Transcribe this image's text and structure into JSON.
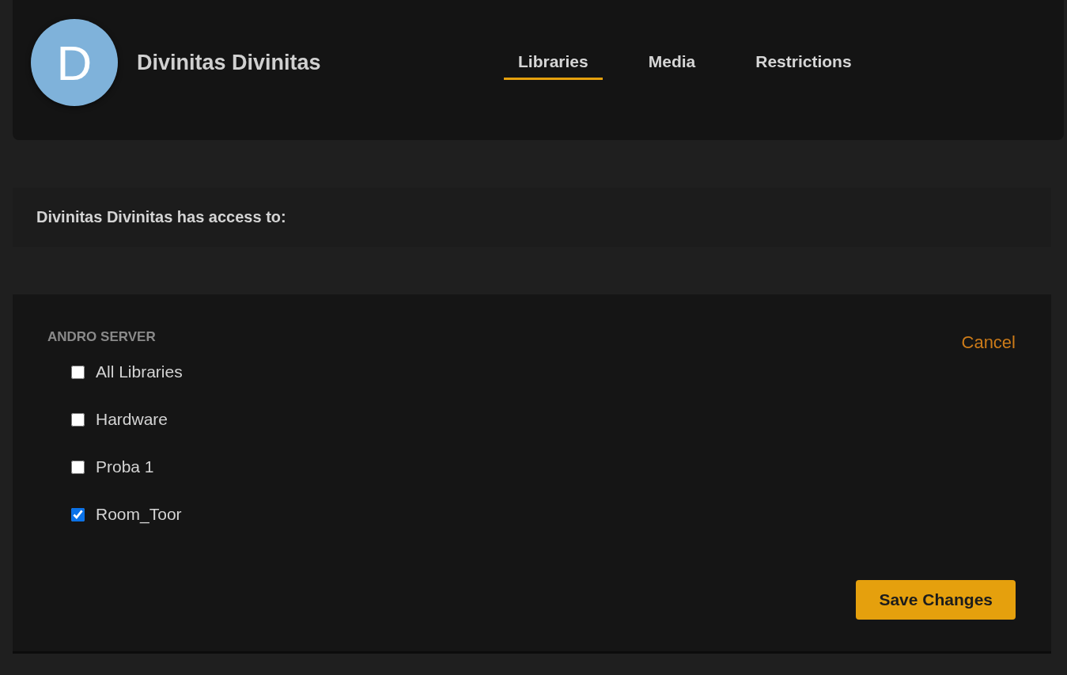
{
  "user": {
    "initial": "D",
    "name": "Divinitas Divinitas"
  },
  "tabs": [
    {
      "label": "Libraries",
      "selected": true
    },
    {
      "label": "Media",
      "selected": false
    },
    {
      "label": "Restrictions",
      "selected": false
    }
  ],
  "access_heading": "Divinitas Divinitas has access to:",
  "server": {
    "name": "ANDRO SERVER",
    "cancel": "Cancel",
    "libraries": [
      {
        "label": "All Libraries",
        "checked": false
      },
      {
        "label": "Hardware",
        "checked": false
      },
      {
        "label": "Proba 1",
        "checked": false
      },
      {
        "label": "Room_Toor",
        "checked": true
      }
    ]
  },
  "save_button": "Save Changes"
}
